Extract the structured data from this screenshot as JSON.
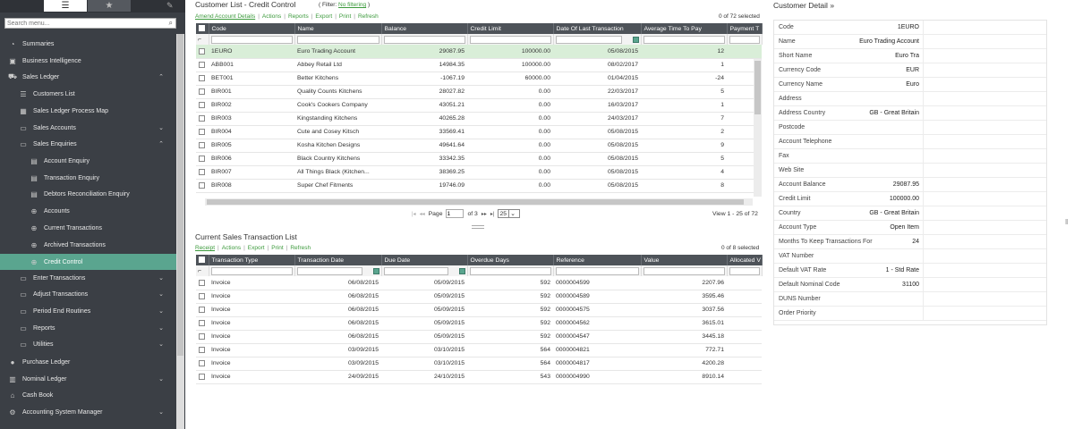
{
  "sidebar": {
    "search_placeholder": "Search menu...",
    "items": [
      {
        "label": "Summaries",
        "icon": "pie-chart-icon"
      },
      {
        "label": "Business Intelligence",
        "icon": "cubes-icon"
      },
      {
        "label": "Sales Ledger",
        "icon": "shopping-cart-icon"
      },
      {
        "label": "Customers List",
        "icon": "list-icon"
      },
      {
        "label": "Sales Ledger Process Map",
        "icon": "process-map-icon"
      },
      {
        "label": "Sales Accounts",
        "icon": "folder-icon"
      },
      {
        "label": "Sales Enquiries",
        "icon": "folder-icon"
      },
      {
        "label": "Account Enquiry",
        "icon": "enquiry-icon"
      },
      {
        "label": "Transaction Enquiry",
        "icon": "enquiry-icon"
      },
      {
        "label": "Debtors Reconciliation Enquiry",
        "icon": "enquiry-icon"
      },
      {
        "label": "Accounts",
        "icon": "globe-icon"
      },
      {
        "label": "Current Transactions",
        "icon": "globe-icon"
      },
      {
        "label": "Archived Transactions",
        "icon": "globe-icon"
      },
      {
        "label": "Credit Control",
        "icon": "globe-icon"
      },
      {
        "label": "Enter Transactions",
        "icon": "folder-icon"
      },
      {
        "label": "Adjust Transactions",
        "icon": "folder-icon"
      },
      {
        "label": "Period End Routines",
        "icon": "folder-icon"
      },
      {
        "label": "Reports",
        "icon": "folder-icon"
      },
      {
        "label": "Utilities",
        "icon": "folder-icon"
      },
      {
        "label": "Purchase Ledger",
        "icon": "person-icon"
      },
      {
        "label": "Nominal Ledger",
        "icon": "book-icon"
      },
      {
        "label": "Cash Book",
        "icon": "bank-icon"
      },
      {
        "label": "Accounting System Manager",
        "icon": "settings-icon"
      }
    ]
  },
  "customer_list": {
    "title": "Customer List - Credit Control",
    "filter_prefix": "( Filter:",
    "filter_value": "No filtering",
    "filter_suffix": ")",
    "links": [
      "Amend Account Details",
      "Actions",
      "Reports",
      "Export",
      "Print",
      "Refresh"
    ],
    "selected_count": "0 of 72 selected",
    "columns": [
      "Code",
      "Name",
      "Balance",
      "Credit Limit",
      "Date Of Last Transaction",
      "Average Time To Pay",
      "Payment T"
    ],
    "rows": [
      [
        "1EURO",
        "Euro Trading Account",
        "29087.95",
        "100000.00",
        "05/08/2015",
        "12"
      ],
      [
        "ABB001",
        "Abbey Retail Ltd",
        "14984.35",
        "100000.00",
        "08/02/2017",
        "1"
      ],
      [
        "BET001",
        "Better Kitchens",
        "-1067.19",
        "60000.00",
        "01/04/2015",
        "-24"
      ],
      [
        "BIR001",
        "Quality Counts Kitchens",
        "28027.82",
        "0.00",
        "22/03/2017",
        "5"
      ],
      [
        "BIR002",
        "Cook's Cookers Company",
        "43051.21",
        "0.00",
        "16/03/2017",
        "1"
      ],
      [
        "BIR003",
        "Kingstanding Kitchens",
        "40265.28",
        "0.00",
        "24/03/2017",
        "7"
      ],
      [
        "BIR004",
        "Cute and Cosey Kitsch",
        "33569.41",
        "0.00",
        "05/08/2015",
        "2"
      ],
      [
        "BIR005",
        "Kosha Kitchen Designs",
        "49641.64",
        "0.00",
        "05/08/2015",
        "9"
      ],
      [
        "BIR006",
        "Black Country Kitchens",
        "33342.35",
        "0.00",
        "05/08/2015",
        "5"
      ],
      [
        "BIR007",
        "All Things Black (Kitchen...",
        "38369.25",
        "0.00",
        "05/08/2015",
        "4"
      ],
      [
        "BIR008",
        "Super Chef Fitments",
        "19746.09",
        "0.00",
        "05/08/2015",
        "8"
      ]
    ],
    "pager": {
      "page_label": "Page",
      "page_value": "1",
      "of_label": "of 3",
      "page_size": "25",
      "view_info": "View 1 - 25 of 72"
    }
  },
  "transactions": {
    "title": "Current Sales Transaction List",
    "links": [
      "Receipt",
      "Actions",
      "Export",
      "Print",
      "Refresh"
    ],
    "selected_count": "0 of 8 selected",
    "columns": [
      "Transaction Type",
      "Transaction Date",
      "Due Date",
      "Overdue Days",
      "Reference",
      "Value",
      "Allocated V"
    ],
    "rows": [
      [
        "Invoice",
        "06/08/2015",
        "05/09/2015",
        "592",
        "0000004599",
        "2207.96"
      ],
      [
        "Invoice",
        "06/08/2015",
        "05/09/2015",
        "592",
        "0000004589",
        "3595.46"
      ],
      [
        "Invoice",
        "06/08/2015",
        "05/09/2015",
        "592",
        "0000004575",
        "3037.56"
      ],
      [
        "Invoice",
        "06/08/2015",
        "05/09/2015",
        "592",
        "0000004562",
        "3615.01"
      ],
      [
        "Invoice",
        "06/08/2015",
        "05/09/2015",
        "592",
        "0000004547",
        "3445.18"
      ],
      [
        "Invoice",
        "03/09/2015",
        "03/10/2015",
        "564",
        "0000004821",
        "772.71"
      ],
      [
        "Invoice",
        "03/09/2015",
        "03/10/2015",
        "564",
        "0000004817",
        "4200.28"
      ],
      [
        "Invoice",
        "24/09/2015",
        "24/10/2015",
        "543",
        "0000004990",
        "8910.14"
      ]
    ]
  },
  "detail": {
    "title": "Customer Detail",
    "title_icon": "chevron-down-icon",
    "fields": [
      [
        "Code",
        "1EURO"
      ],
      [
        "Name",
        "Euro Trading Account"
      ],
      [
        "Short Name",
        "Euro Tra"
      ],
      [
        "Currency Code",
        "EUR"
      ],
      [
        "Currency Name",
        "Euro"
      ],
      [
        "Address",
        ""
      ],
      [
        "Address Country",
        "GB - Great Britain"
      ],
      [
        "Postcode",
        ""
      ],
      [
        "Account Telephone",
        ""
      ],
      [
        "Fax",
        ""
      ],
      [
        "Web Site",
        ""
      ],
      [
        "Account Balance",
        "29087.95"
      ],
      [
        "Credit Limit",
        "100000.00"
      ],
      [
        "Country",
        "GB - Great Britain"
      ],
      [
        "Account Type",
        "Open Item"
      ],
      [
        "Months To Keep Transactions For",
        "24"
      ],
      [
        "VAT Number",
        ""
      ],
      [
        "Default VAT Rate",
        "1 - Std Rate"
      ],
      [
        "Default Nominal Code",
        "31100"
      ],
      [
        "DUNS Number",
        ""
      ],
      [
        "Order Priority",
        ""
      ]
    ]
  },
  "colors": {
    "accent": "#5aa58f",
    "sidebar_bg": "#3b3f45",
    "header_bg": "#4e5359",
    "link": "#3c9a3c",
    "selected_row": "#d9eed8"
  }
}
